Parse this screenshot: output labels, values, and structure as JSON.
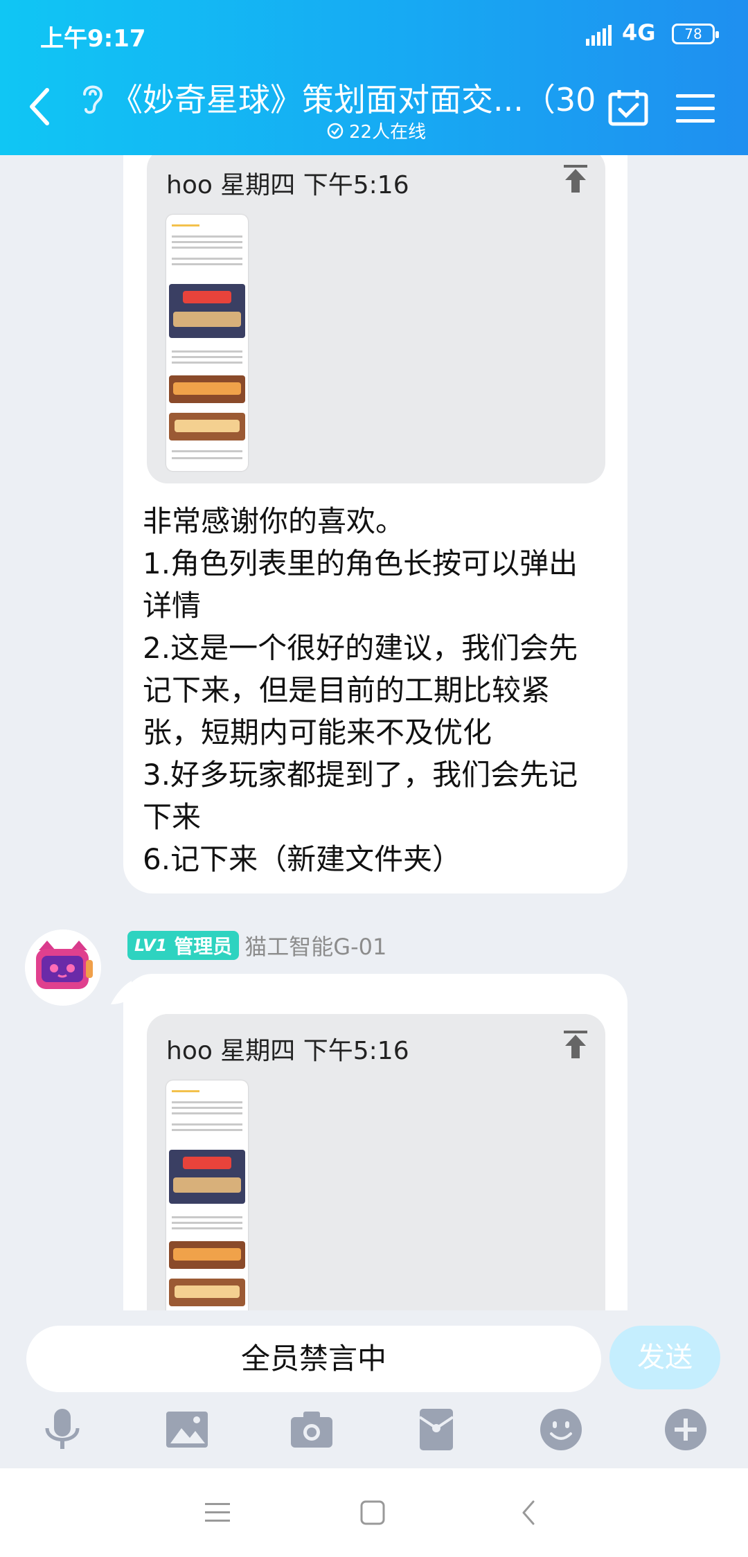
{
  "status_bar": {
    "time": "上午9:17",
    "network": "4G",
    "battery": "78"
  },
  "header": {
    "title": "《妙奇星球》策划面对面交...（30）",
    "online": "22人在线"
  },
  "messages": [
    {
      "quote": {
        "author_time": "hoo 星期四 下午5:16"
      },
      "text": "非常感谢你的喜欢。\n1.角色列表里的角色长按可以弹出详情\n2.这是一个很好的建议，我们会先记下来，但是目前的工期比较紧张，短期内可能来不及优化\n3.好多玩家都提到了，我们会先记下来\n6.记下来（新建文件夹）"
    },
    {
      "sender": {
        "level": "LV1",
        "role": "管理员",
        "name": "猫工智能G-01"
      },
      "quote": {
        "author_time": "hoo 星期四 下午5:16"
      }
    }
  ],
  "input": {
    "placeholder": "全员禁言中",
    "send_label": "发送"
  },
  "toolbar": [
    "microphone-icon",
    "image-icon",
    "camera-icon",
    "red-packet-icon",
    "emoji-icon",
    "plus-icon"
  ],
  "colors": {
    "header_start": "#10c6f4",
    "header_end": "#1f8ff0",
    "badge": "#2ed3c0",
    "send_disabled": "#c5eefe"
  }
}
